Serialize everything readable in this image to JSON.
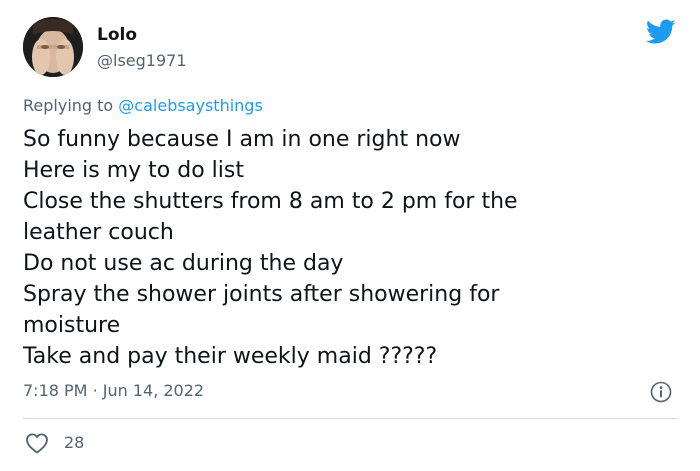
{
  "tweet": {
    "author": {
      "display_name": "Lolo",
      "handle": "@lseg1971",
      "avatar_icon": "avatar-photo"
    },
    "brand": {
      "icon": "twitter-bird-icon",
      "color": "#1d9bf0"
    },
    "reply": {
      "prefix": "Replying to",
      "mention": "@calebsaysthings"
    },
    "lines": [
      "So funny because I am in one right now",
      "Here is my to do list",
      "Close the shutters from 8 am to 2 pm for the",
      "leather couch",
      "Do not use ac during the day",
      "Spray the shower joints after showering for",
      "moisture",
      "Take and pay their weekly maid ?????"
    ],
    "timestamp": {
      "time": "7:18 PM",
      "separator": "·",
      "date": "Jun 14, 2022"
    },
    "info_icon": "info-icon",
    "likes": {
      "icon": "heart-icon",
      "count": "28"
    }
  },
  "colors": {
    "text": "#0f1419",
    "secondary": "#536471",
    "accent": "#1d9bf0",
    "divider": "#cfd9de"
  }
}
